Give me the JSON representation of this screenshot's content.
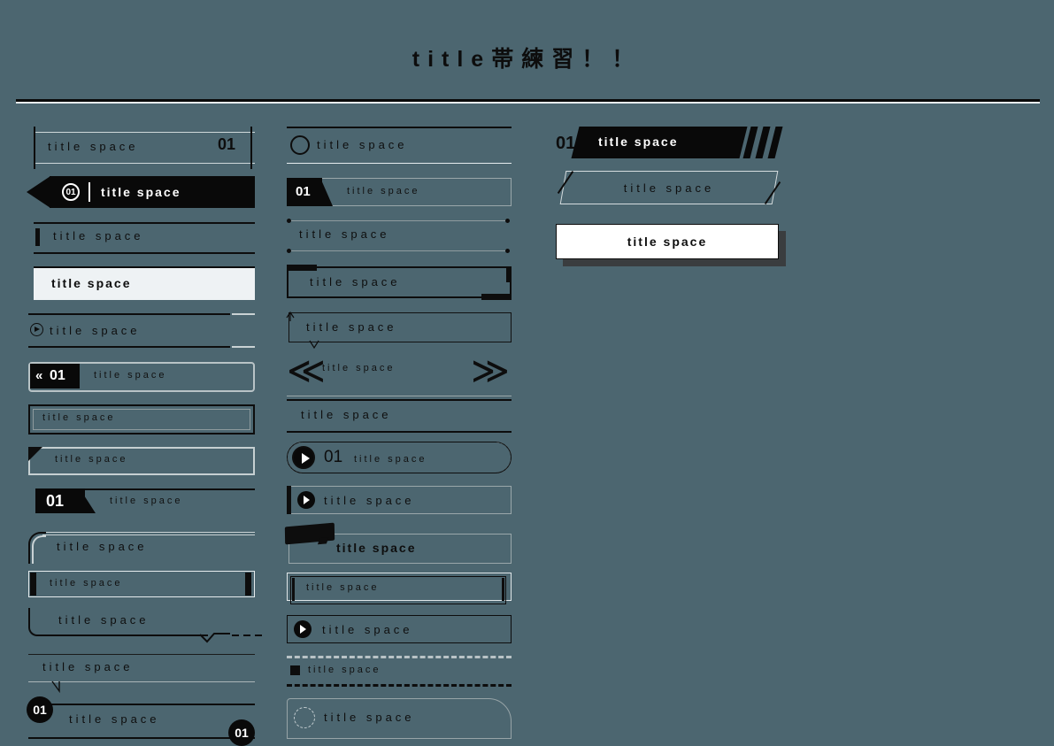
{
  "page": {
    "title": "title帯練習！！",
    "background_color": "#4c6670",
    "ink_color": "#0d0d0d",
    "paper_color": "#eef2f4"
  },
  "label": "title space",
  "number": "01",
  "columns": [
    {
      "name": "column-1",
      "items": [
        {
          "id": "c1-1",
          "style": "rule-with-end-ticks-and-number",
          "text": "title space",
          "number": "01"
        },
        {
          "id": "c1-2",
          "style": "black-banner-arrow-circle-number",
          "text": "title space",
          "number": "01"
        },
        {
          "id": "c1-3",
          "style": "double-rule-with-tab",
          "text": "title space"
        },
        {
          "id": "c1-4",
          "style": "filled-light-box",
          "text": "title space"
        },
        {
          "id": "c1-5",
          "style": "double-rule-play-icon",
          "text": "title space"
        },
        {
          "id": "c1-6",
          "style": "rounded-box-chevron-number-chip",
          "text": "title space",
          "number": "01",
          "chevrons": "«"
        },
        {
          "id": "c1-7",
          "style": "double-border-box",
          "text": "title space"
        },
        {
          "id": "c1-8",
          "style": "box-folded-corner",
          "text": "title space"
        },
        {
          "id": "c1-9",
          "style": "rule-with-slanted-number-tag",
          "text": "title space",
          "number": "01"
        },
        {
          "id": "c1-10",
          "style": "rounded-corner-rule",
          "text": "title space"
        },
        {
          "id": "c1-11",
          "style": "thin-box-black-endcaps",
          "text": "title space"
        },
        {
          "id": "c1-12",
          "style": "corner-rule-squiggle-dashes",
          "text": "title space"
        },
        {
          "id": "c1-13",
          "style": "double-rule-tick",
          "text": "title space"
        },
        {
          "id": "c1-14",
          "style": "rules-with-circle-badges",
          "text": "title space",
          "number": "01",
          "number_right": "01"
        }
      ]
    },
    {
      "name": "column-2",
      "items": [
        {
          "id": "c2-1",
          "style": "rule-with-circle-outline",
          "text": "title space"
        },
        {
          "id": "c2-2",
          "style": "box-slanted-number-tag",
          "text": "title space",
          "number": "01"
        },
        {
          "id": "c2-3",
          "style": "rules-with-corner-dots",
          "text": "title space"
        },
        {
          "id": "c2-4",
          "style": "box-with-corner-keys",
          "text": "title space"
        },
        {
          "id": "c2-5",
          "style": "box-with-pin-marks",
          "text": "title space"
        },
        {
          "id": "c2-6",
          "style": "double-chevrons-left-right",
          "text": "title space",
          "chevron_left": "≪",
          "chevron_right": "≫"
        },
        {
          "id": "c2-7",
          "style": "triple-rule",
          "text": "title space"
        },
        {
          "id": "c2-8",
          "style": "pill-play-icon-number",
          "text": "title space",
          "number": "01"
        },
        {
          "id": "c2-9",
          "style": "box-left-bar-play-icon",
          "text": "title space"
        },
        {
          "id": "c2-10",
          "style": "box-with-brush-stroke",
          "text": "title space"
        },
        {
          "id": "c2-11",
          "style": "offset-double-box-endcaps",
          "text": "title space"
        },
        {
          "id": "c2-12",
          "style": "box-play-icon",
          "text": "title space"
        },
        {
          "id": "c2-13",
          "style": "dashed-rules-square-bullet",
          "text": "title space"
        },
        {
          "id": "c2-14",
          "style": "rounded-corner-box-dashed-circle",
          "text": "title space"
        }
      ]
    },
    {
      "name": "column-3",
      "items": [
        {
          "id": "c3-1",
          "style": "black-slant-banner-stripes",
          "text": "title space",
          "number": "01"
        },
        {
          "id": "c3-2",
          "style": "parallelogram-outline-accents",
          "text": "title space"
        },
        {
          "id": "c3-3",
          "style": "white-box-drop-shadow",
          "text": "title space"
        }
      ]
    }
  ]
}
